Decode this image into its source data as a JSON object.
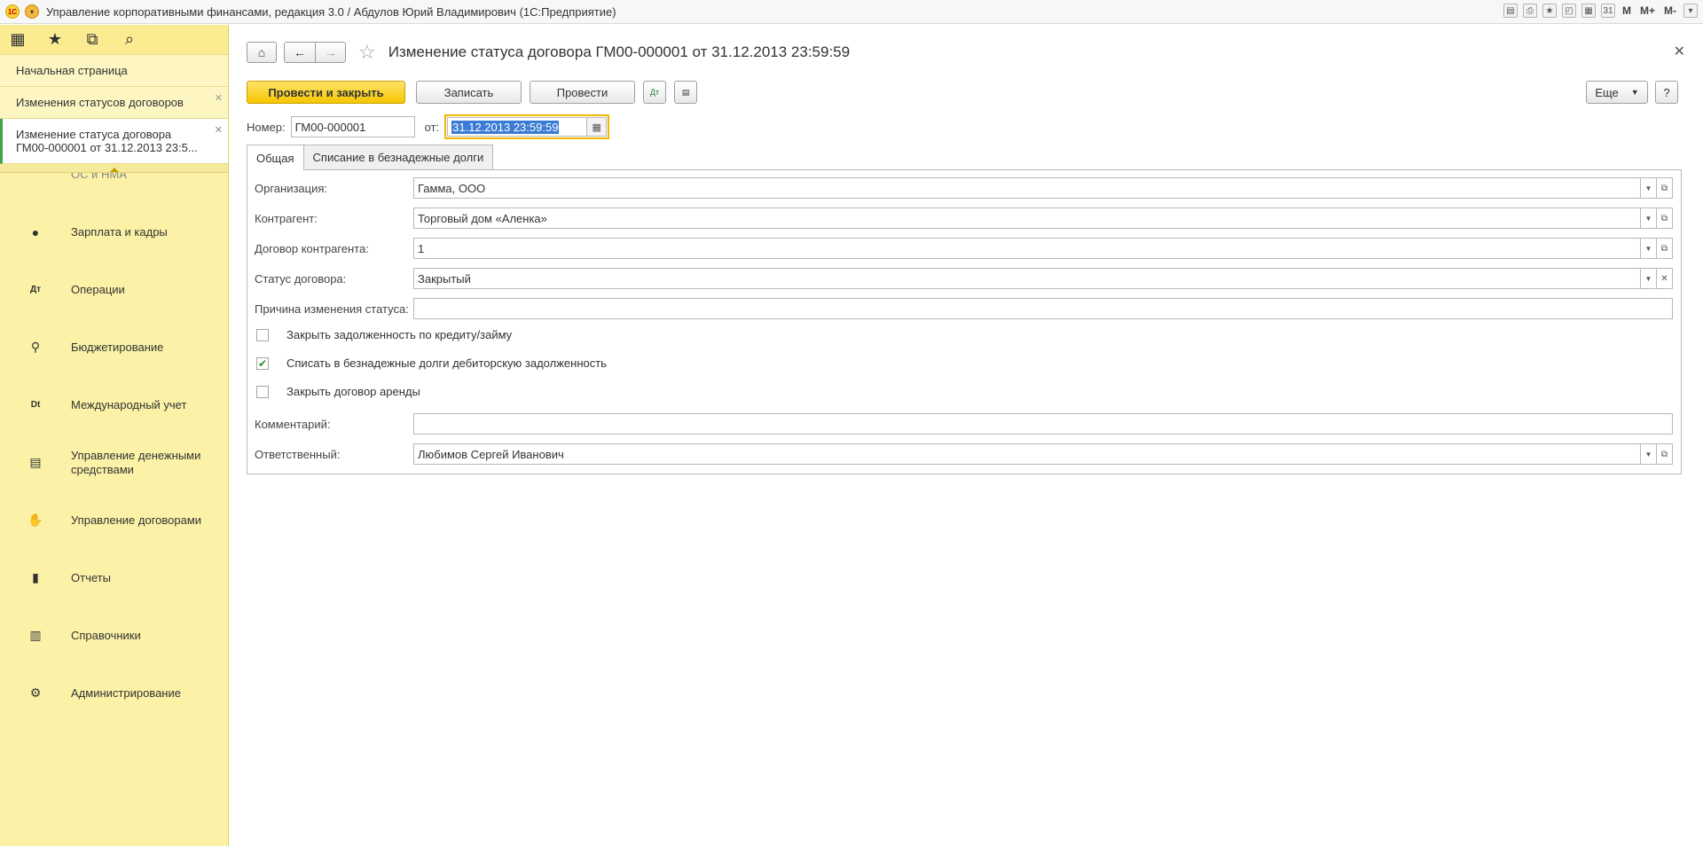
{
  "titlebar": {
    "logo": "1С",
    "title": "Управление корпоративными финансами, редакция 3.0 / Абдулов Юрий Владимирович (1С:Предприятие)",
    "tools": [
      "M",
      "M+",
      "M-"
    ]
  },
  "sidebar": {
    "open_items": [
      {
        "label": "Начальная страница"
      },
      {
        "label": "Изменения статусов договоров"
      },
      {
        "label_line1": "Изменение статуса договора",
        "label_line2": "ГМ00-000001 от 31.12.2013 23:5..."
      }
    ],
    "cut_item": "ОС и НМА",
    "sections": [
      {
        "label": "Зарплата и кадры",
        "icon": "person-icon"
      },
      {
        "label": "Операции",
        "icon": "dt-kt-icon"
      },
      {
        "label": "Бюджетирование",
        "icon": "budget-icon"
      },
      {
        "label": "Международный учет",
        "icon": "dt-ct-icon"
      },
      {
        "label": "Управление денежными средствами",
        "icon": "money-icon"
      },
      {
        "label": "Управление договорами",
        "icon": "handshake-icon"
      },
      {
        "label": "Отчеты",
        "icon": "bar-chart-icon"
      },
      {
        "label": "Справочники",
        "icon": "books-icon"
      },
      {
        "label": "Администрирование",
        "icon": "gear-icon"
      }
    ]
  },
  "document": {
    "title": "Изменение статуса договора ГМ00-000001 от 31.12.2013 23:59:59",
    "buttons": {
      "post_close": "Провести и закрыть",
      "save": "Записать",
      "post": "Провести",
      "more": "Еще",
      "help": "?"
    },
    "number_label": "Номер:",
    "number_value": "ГМ00-000001",
    "date_label": "от:",
    "date_value": "31.12.2013 23:59:59",
    "tabs": [
      "Общая",
      "Списание в безнадежные долги"
    ],
    "fields": {
      "org_label": "Организация:",
      "org_value": "Гамма, ООО",
      "contractor_label": "Контрагент:",
      "contractor_value": "Торговый дом «Аленка»",
      "contract_label": "Договор контрагента:",
      "contract_value": "1",
      "status_label": "Статус договора:",
      "status_value": "Закрытый",
      "reason_label": "Причина изменения статуса:",
      "reason_value": "",
      "chk1_label": "Закрыть задолженность по кредиту/займу",
      "chk1_checked": false,
      "chk2_label": "Списать в безнадежные долги дебиторскую задолженность",
      "chk2_checked": true,
      "chk3_label": "Закрыть договор аренды",
      "chk3_checked": false,
      "comment_label": "Комментарий:",
      "comment_value": "",
      "responsible_label": "Ответственный:",
      "responsible_value": "Любимов Сергей Иванович"
    }
  },
  "colors": {
    "sidebar_bg": "#fbf2a7",
    "primary_button": "#f6c600",
    "active_marker": "#3fa34d",
    "date_focus": "#f2b800"
  }
}
